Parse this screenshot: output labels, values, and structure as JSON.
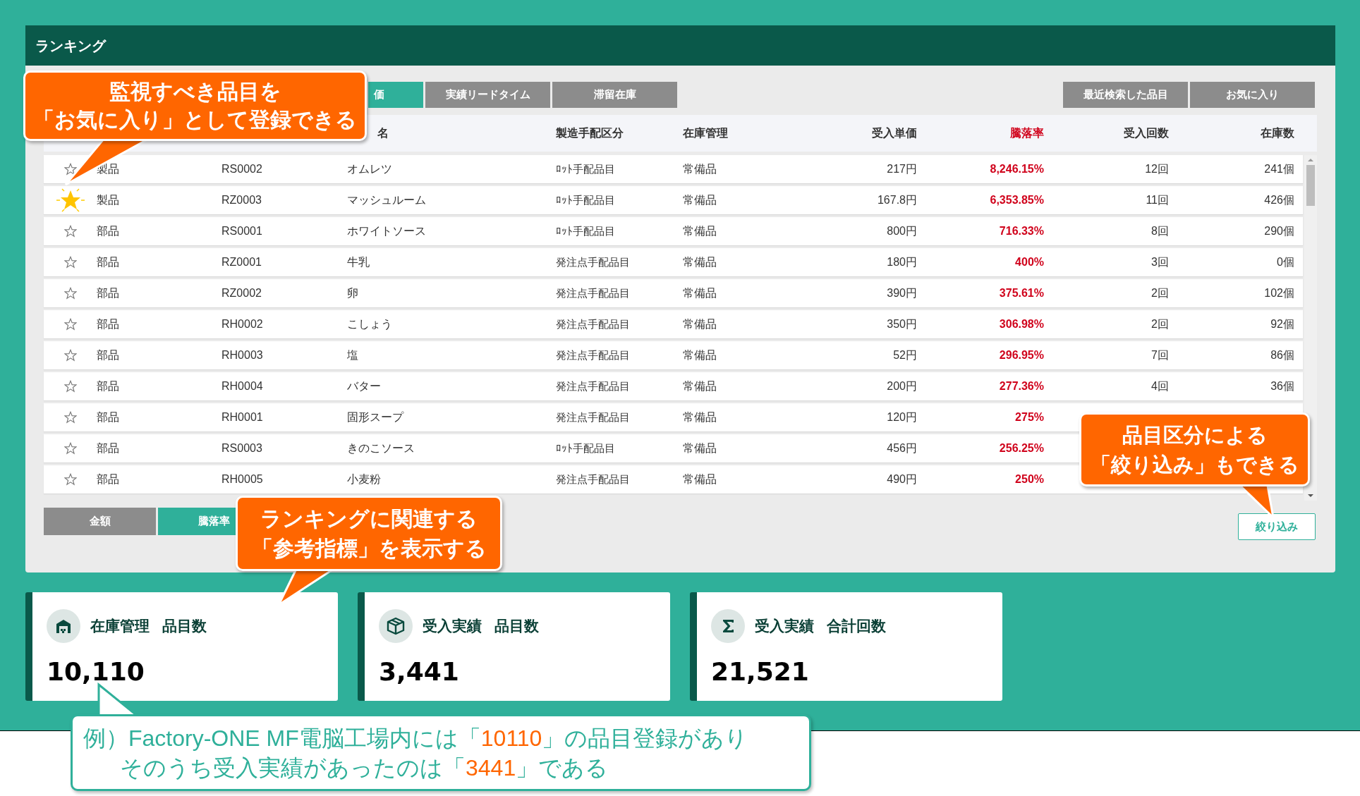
{
  "panel": {
    "title": "ランキング"
  },
  "ranking_tabs": [
    {
      "label": "価",
      "selected": true
    },
    {
      "label": "実績リードタイム",
      "selected": false
    },
    {
      "label": "滞留在庫",
      "selected": false
    }
  ],
  "list_tabs": [
    {
      "label": "最近検索した品目",
      "selected": false
    },
    {
      "label": "お気に入り",
      "selected": false
    }
  ],
  "table": {
    "columns": [
      {
        "label": "名",
        "highlight": false
      },
      {
        "label": "製造手配区分",
        "highlight": false
      },
      {
        "label": "在庫管理",
        "highlight": false
      },
      {
        "label": "受入単価",
        "highlight": false
      },
      {
        "label": "騰落率",
        "highlight": true
      },
      {
        "label": "受入回数",
        "highlight": false
      },
      {
        "label": "在庫数",
        "highlight": false
      }
    ],
    "rows": [
      {
        "favorite": false,
        "category": "製品",
        "code": "RS0002",
        "cells": [
          "オムレツ",
          "ﾛｯﾄ手配品目",
          "常備品",
          "217円",
          "8,246.15%",
          "12回",
          "241個"
        ]
      },
      {
        "favorite": true,
        "category": "製品",
        "code": "RZ0003",
        "cells": [
          "マッシュルーム",
          "ﾛｯﾄ手配品目",
          "常備品",
          "167.8円",
          "6,353.85%",
          "11回",
          "426個"
        ]
      },
      {
        "favorite": false,
        "category": "部品",
        "code": "RS0001",
        "cells": [
          "ホワイトソース",
          "ﾛｯﾄ手配品目",
          "常備品",
          "800円",
          "716.33%",
          "8回",
          "290個"
        ]
      },
      {
        "favorite": false,
        "category": "部品",
        "code": "RZ0001",
        "cells": [
          "牛乳",
          "発注点手配品目",
          "常備品",
          "180円",
          "400%",
          "3回",
          "0個"
        ]
      },
      {
        "favorite": false,
        "category": "部品",
        "code": "RZ0002",
        "cells": [
          "卵",
          "発注点手配品目",
          "常備品",
          "390円",
          "375.61%",
          "2回",
          "102個"
        ]
      },
      {
        "favorite": false,
        "category": "部品",
        "code": "RH0002",
        "cells": [
          "こしょう",
          "発注点手配品目",
          "常備品",
          "350円",
          "306.98%",
          "2回",
          "92個"
        ]
      },
      {
        "favorite": false,
        "category": "部品",
        "code": "RH0003",
        "cells": [
          "塩",
          "発注点手配品目",
          "常備品",
          "52円",
          "296.95%",
          "7回",
          "86個"
        ]
      },
      {
        "favorite": false,
        "category": "部品",
        "code": "RH0004",
        "cells": [
          "バター",
          "発注点手配品目",
          "常備品",
          "200円",
          "277.36%",
          "4回",
          "36個"
        ]
      },
      {
        "favorite": false,
        "category": "部品",
        "code": "RH0001",
        "cells": [
          "固形スープ",
          "発注点手配品目",
          "常備品",
          "120円",
          "275%"
        ]
      },
      {
        "favorite": false,
        "category": "部品",
        "code": "RS0003",
        "cells": [
          "きのこソース",
          "ﾛｯﾄ手配品目",
          "常備品",
          "456円",
          "256.25%"
        ]
      },
      {
        "favorite": false,
        "category": "部品",
        "code": "RH0005",
        "cells": [
          "小麦粉",
          "発注点手配品目",
          "常備品",
          "490円",
          "250%"
        ]
      }
    ]
  },
  "metric_tabs": [
    {
      "label": "金額",
      "selected": false
    },
    {
      "label": "騰落率",
      "selected": true
    }
  ],
  "filter_button": "絞り込み",
  "cards": [
    {
      "kind": "warehouse",
      "title": "在庫管理",
      "subtitle": "品目数",
      "value": "10,110"
    },
    {
      "kind": "box",
      "title": "受入実績",
      "subtitle": "品目数",
      "value": "3,441"
    },
    {
      "kind": "sigma",
      "title": "受入実績",
      "subtitle": "合計回数",
      "value": "21,521"
    }
  ],
  "callouts": [
    {
      "lines": [
        "監視すべき品目を",
        "「お気に入り」として登録できる"
      ]
    },
    {
      "lines": [
        "ランキングに関連する",
        "「参考指標」を表示する"
      ]
    },
    {
      "lines": [
        "品目区分による",
        "「絞り込み」もできる"
      ]
    }
  ],
  "note": {
    "lines": [
      [
        {
          "text": "例）Factory-ONE MF電脳工場内には「",
          "emphasis": false
        },
        {
          "text": "10110",
          "emphasis": true
        },
        {
          "text": "」の品目登録があり",
          "emphasis": false
        }
      ],
      [
        {
          "text": "そのうち受入実績があったのは「",
          "emphasis": false
        },
        {
          "text": "3441",
          "emphasis": true
        },
        {
          "text": "」である",
          "emphasis": false
        }
      ]
    ]
  }
}
